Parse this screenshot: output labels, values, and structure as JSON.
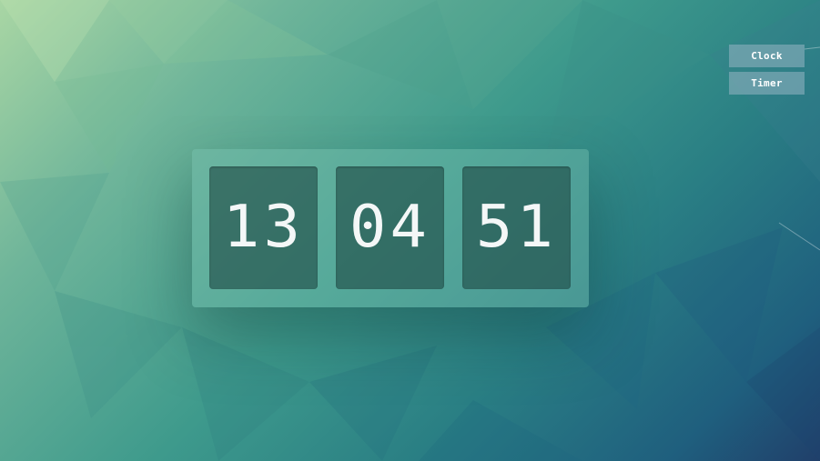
{
  "modes": {
    "clock_label": "Clock",
    "timer_label": "Timer"
  },
  "clock": {
    "hours": "13",
    "minutes": "04",
    "seconds": "51"
  },
  "colors": {
    "panel": "#6fbfae",
    "card": "#245a55",
    "digit": "#f4f7f7",
    "button": "#96b4c3"
  }
}
